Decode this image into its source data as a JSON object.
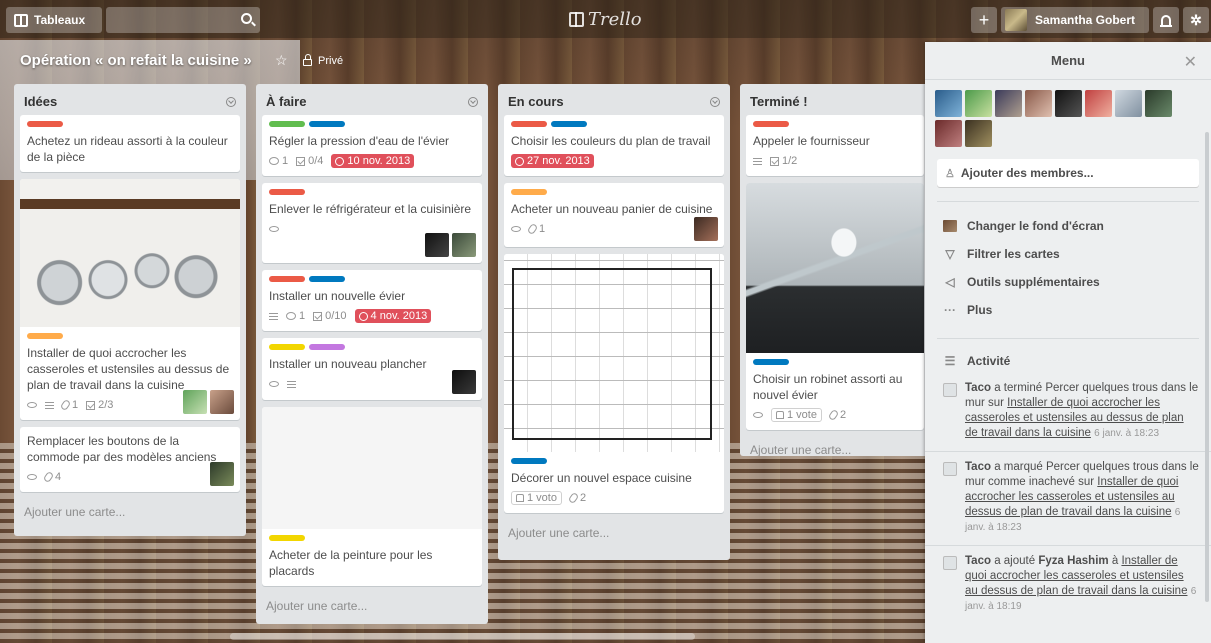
{
  "header": {
    "boards_label": "Tableaux",
    "logo_text": "Trello",
    "plus_label": "+",
    "user_name": "Samantha Gobert"
  },
  "board": {
    "title": "Opération « on refait la cuisine »",
    "visibility": "Privé"
  },
  "colors": {
    "green": "#61bd4f",
    "yellow": "#f2d600",
    "orange": "#ffab4a",
    "red": "#eb5a46",
    "purple": "#c377e0",
    "blue": "#0079bf",
    "due_red": "#e0505b"
  },
  "lists": [
    {
      "title": "Idées",
      "add_card": "Ajouter une carte...",
      "cards": [
        {
          "labels": [
            "red"
          ],
          "title": "Achetez un rideau assorti à la couleur de la pièce"
        },
        {
          "labels": [
            "orange"
          ],
          "title": "Installer de quoi accrocher les casseroles et ustensiles au dessus de plan de travail dans la cuisine",
          "badges": {
            "attachments": "1",
            "checklist": "2/3"
          },
          "members": 2
        },
        {
          "labels": [],
          "title": "Remplacer les boutons de la commode par des modèles anciens",
          "badges": {
            "attachments": "4"
          },
          "members": 1
        }
      ]
    },
    {
      "title": "À faire",
      "add_card": "Ajouter une carte...",
      "cards": [
        {
          "labels": [
            "green",
            "blue"
          ],
          "title": "Régler la pression d'eau de l'évier",
          "badges": {
            "comments": "1",
            "checklist": "0/4",
            "due": "10 nov. 2013"
          }
        },
        {
          "labels": [
            "red"
          ],
          "title": "Enlever le réfrigérateur et la cuisinière",
          "members": 2
        },
        {
          "labels": [
            "red",
            "blue"
          ],
          "title": "Installer un nouvelle évier",
          "badges": {
            "comments": "1",
            "checklist": "0/10",
            "due": "4 nov. 2013"
          }
        },
        {
          "labels": [
            "yellow",
            "purple"
          ],
          "title": "Installer un nouveau plancher",
          "members": 1
        },
        {
          "labels": [
            "yellow"
          ],
          "title": "Acheter de la peinture pour les placards"
        }
      ]
    },
    {
      "title": "En cours",
      "add_card": "Ajouter une carte...",
      "cards": [
        {
          "labels": [
            "red",
            "blue"
          ],
          "title": "Choisir les couleurs du plan de travail",
          "badges": {
            "due": "27 nov. 2013"
          }
        },
        {
          "labels": [
            "orange"
          ],
          "title": "Acheter un nouveau panier de cuisine",
          "badges": {
            "attachments": "1"
          },
          "members": 1
        },
        {
          "labels": [
            "blue"
          ],
          "title": "Décorer un nouvel espace cuisine",
          "badges": {
            "votes": "1 voto",
            "attachments": "2"
          }
        }
      ]
    },
    {
      "title": "Terminé !",
      "add_card": "Ajouter une carte...",
      "cards": [
        {
          "labels": [
            "red"
          ],
          "title": "Appeler le fournisseur",
          "badges": {
            "checklist": "1/2"
          }
        },
        {
          "labels": [
            "blue"
          ],
          "title": "Choisir un robinet assorti au nouvel évier",
          "badges": {
            "votes": "1 vote",
            "attachments": "2"
          }
        }
      ]
    }
  ],
  "menu": {
    "title": "Menu",
    "add_members": "Ajouter des membres...",
    "items": [
      {
        "icon": "background-thumb-icon",
        "label": "Changer le fond d'écran"
      },
      {
        "icon": "filter-icon",
        "label": "Filtrer les cartes"
      },
      {
        "icon": "power-ups-icon",
        "label": "Outils supplémentaires"
      },
      {
        "icon": "more-icon",
        "label": "Plus"
      }
    ],
    "activity_title": "Activité",
    "activity": [
      {
        "user": "Taco",
        "action": " a terminé Percer quelques trous dans le mur sur ",
        "link": "Installer de quoi accrocher les casseroles et ustensiles au dessus de plan de travail dans la cuisine",
        "date": "6 janv. à 18:23"
      },
      {
        "user": "Taco",
        "action": " a marqué Percer quelques trous dans le mur comme inachevé sur ",
        "link": "Installer de quoi accrocher les casseroles et ustensiles au dessus de plan de travail dans la cuisine",
        "date": "6 janv. à 18:23"
      },
      {
        "user": "Taco",
        "action": " a ajouté ",
        "target": "Fyza Hashim",
        "action2": " à ",
        "link": "Installer de quoi accrocher les casseroles et ustensiles au dessus de plan de travail dans la cuisine",
        "date": "6 janv. à 18:19"
      }
    ]
  }
}
